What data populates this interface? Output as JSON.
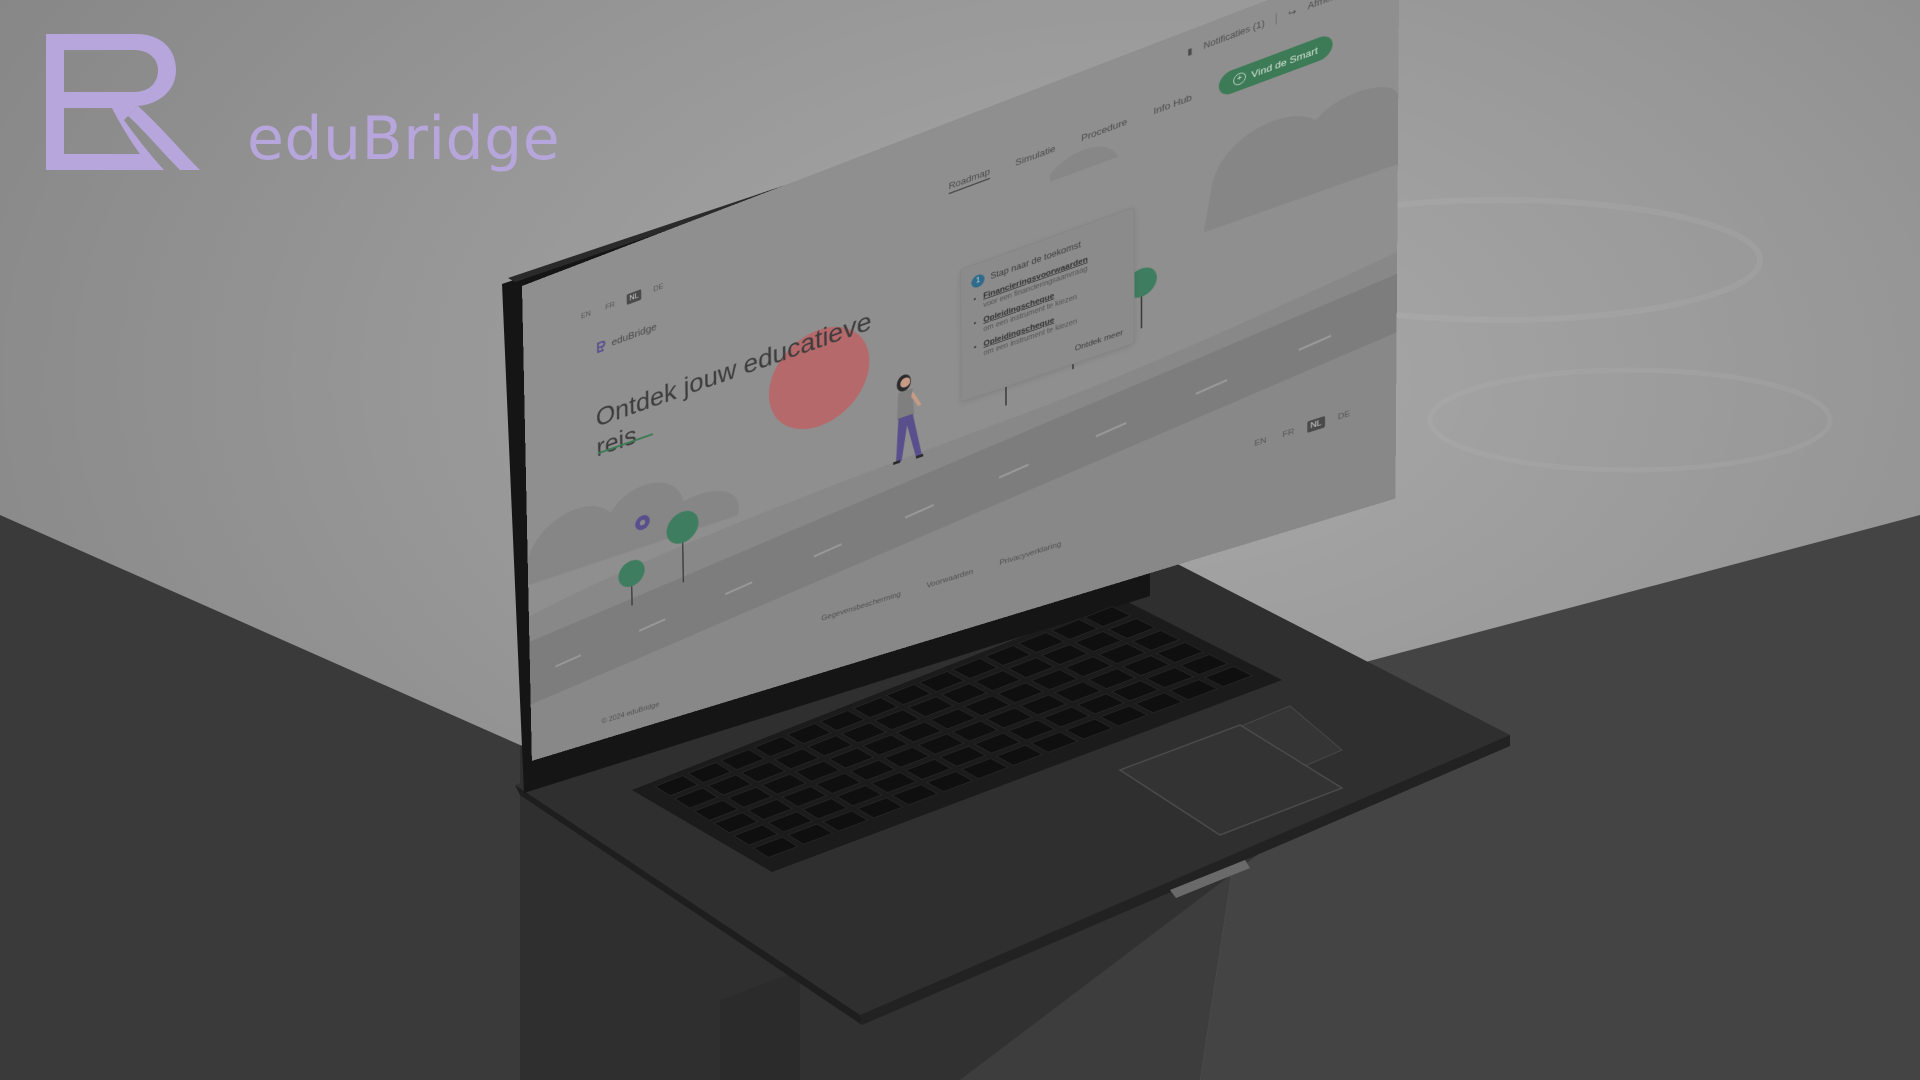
{
  "brand": {
    "name": "eduBridge",
    "accent": "#b7a6dc"
  },
  "site": {
    "logo_text": "eduBridge",
    "languages": [
      "EN",
      "FR",
      "NL",
      "DE"
    ],
    "active_language": "NL",
    "topbar": {
      "notifications": "Notificaties (1)",
      "logout": "Afmelden"
    },
    "nav": [
      {
        "label": "Roadmap",
        "active": true
      },
      {
        "label": "Simulatie",
        "active": false
      },
      {
        "label": "Procedure",
        "active": false
      },
      {
        "label": "Info Hub",
        "active": false
      }
    ],
    "cta_label": "Vind de Smart",
    "hero": {
      "title": "Ontdek jouw educatieve reis"
    },
    "card": {
      "number": "1",
      "title": "Stap naar de toekomst",
      "items": [
        {
          "title": "Financieringsvoorwaarden",
          "desc": "voor een financieringsaanvraag"
        },
        {
          "title": "Opleidingscheque",
          "desc": "om een instrument te kiezen"
        },
        {
          "title": "Opleidingscheque",
          "desc": "om een instrument te kiezen"
        }
      ],
      "more": "Ontdek meer"
    },
    "footer": {
      "links": [
        "Gegevensbescherming",
        "Voorwaarden",
        "Privacyverklaring"
      ],
      "copyright": "© 2024 eduBridge"
    },
    "colors": {
      "accent_green": "#3d7a56",
      "sun": "#b5696b",
      "tree": "#3f7d60",
      "figure_pants": "#5a4f8d"
    },
    "icons": [
      "bell-icon",
      "logout-icon",
      "plus-circle-icon",
      "gear-icon"
    ]
  }
}
